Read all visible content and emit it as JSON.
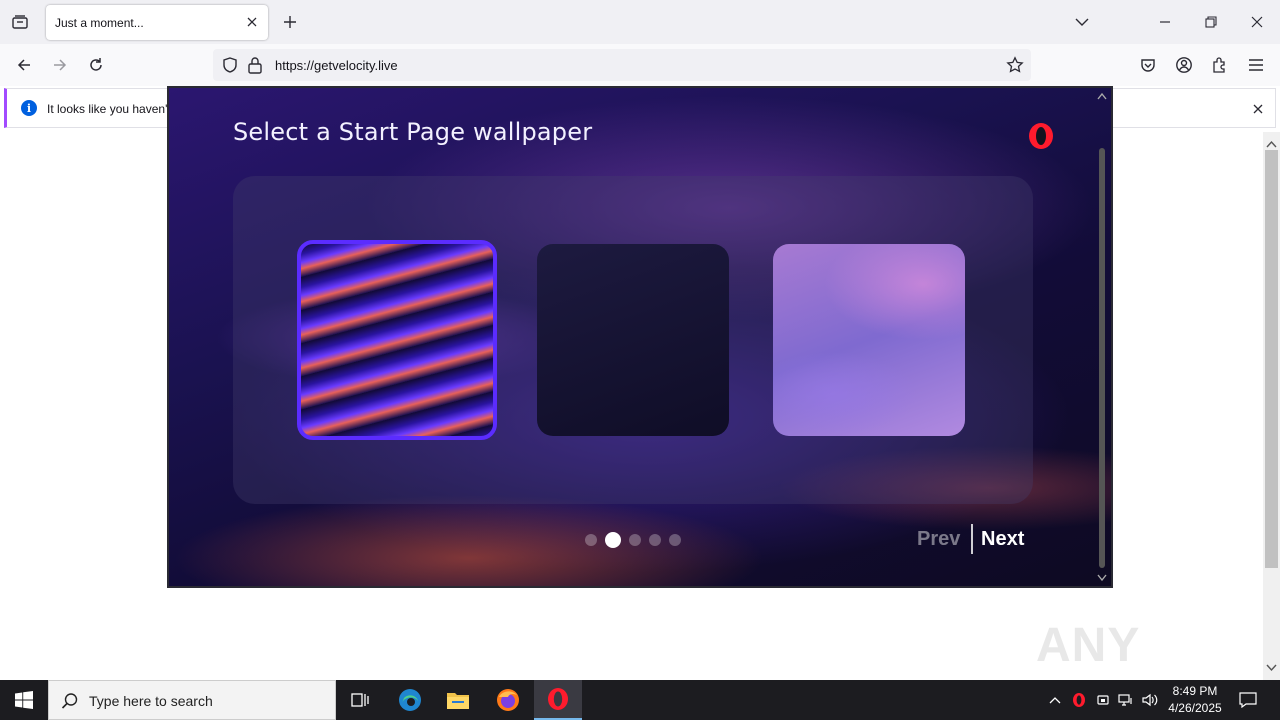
{
  "browser": {
    "tab_title": "Just a moment...",
    "url": "https://getvelocity.live"
  },
  "notification": {
    "text": "It looks like you haven't"
  },
  "popup": {
    "title": "Select a Start Page wallpaper",
    "prev_label": "Prev",
    "next_label": "Next",
    "pager": {
      "total": 5,
      "current": 2
    },
    "selected_wallpaper": 1
  },
  "watermark": {
    "text": "ANY RUN"
  },
  "taskbar": {
    "search_placeholder": "Type here to search",
    "time": "8:49 PM",
    "date": "4/26/2025"
  },
  "colors": {
    "accent": "#5b2cff",
    "opera_red": "#ff1b2d"
  }
}
